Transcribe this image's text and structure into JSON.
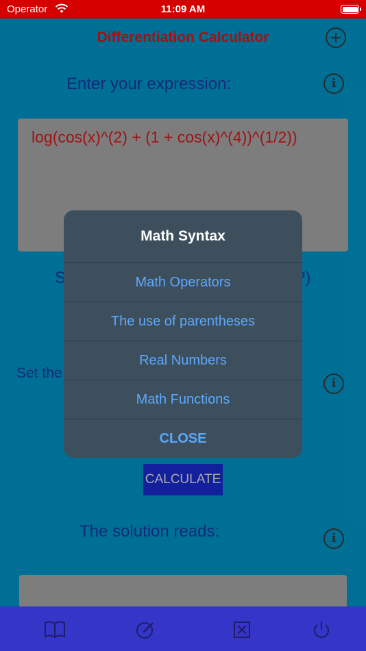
{
  "status_bar": {
    "carrier": "Operator",
    "time": "11:09 AM"
  },
  "app": {
    "title": "Differentiation Calculator",
    "enter_label": "Enter your expression:",
    "expression": "log(cos(x)^(2) + (1 + cos(x)^(4))^(1/2))",
    "partial_left_label": "S",
    "partial_right_label": "?)",
    "set_label": "Set the",
    "calculate_label": "CALCULATE",
    "solution_label": "The solution reads:"
  },
  "dialog": {
    "title": "Math Syntax",
    "items": [
      {
        "label": "Math Operators"
      },
      {
        "label": "The use of parentheses"
      },
      {
        "label": "Real Numbers"
      },
      {
        "label": "Math Functions"
      }
    ],
    "close_label": "CLOSE"
  },
  "toolbar": {
    "icons": [
      "book-icon",
      "edit-icon",
      "clear-icon",
      "power-icon"
    ]
  },
  "colors": {
    "status_bar": "#d40000",
    "background": "#0095c7",
    "title": "#d41a1a",
    "dialog": "#3d4f5c",
    "dialog_link": "#5ba8ff",
    "toolbar": "#3535c8"
  }
}
